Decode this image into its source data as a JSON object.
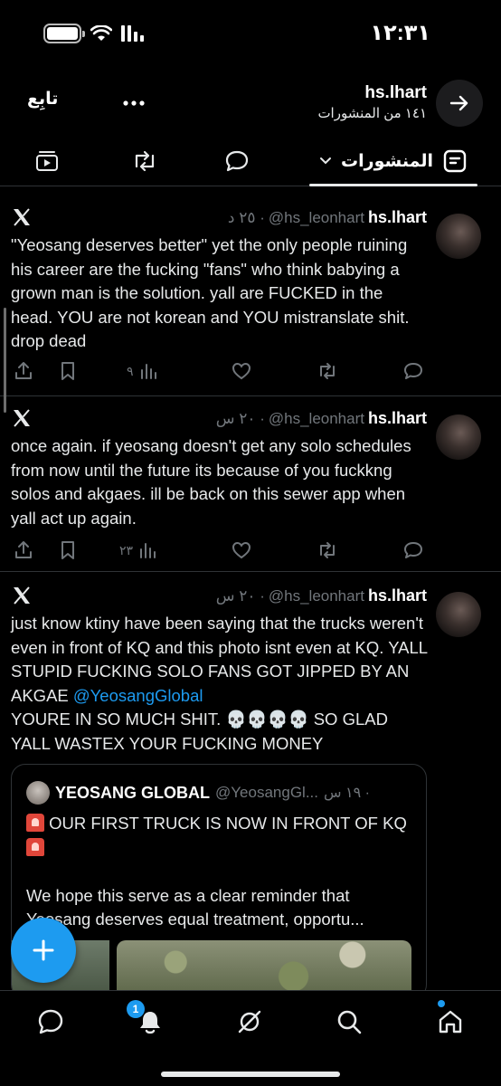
{
  "status_bar": {
    "time": "١٢:٣١"
  },
  "header": {
    "name": "hs.lhart",
    "post_count_label": "١٤١ من المنشورات",
    "follow_label": "تابِع"
  },
  "tabs": {
    "posts_label": "المنشورات"
  },
  "posts": [
    {
      "name": "hs.lhart",
      "handle": "@hs_leonhart",
      "time": "· ٢٥ د",
      "text": "\"Yeosang deserves better\" yet the only people ruining his career are the fucking \"fans\" who think babying a grown man is the solution. yall are FUCKED in the head. YOU are not korean and YOU mistranslate shit. drop dead",
      "views": "٩"
    },
    {
      "name": "hs.lhart",
      "handle": "@hs_leonhart",
      "time": "· ٢٠ س",
      "text": "once again. if yeosang doesn't get any solo schedules from now until the future its because of you fuckkng solos and akgaes. ill be back on this sewer app when yall act up again.",
      "views": "٢٣"
    },
    {
      "name": "hs.lhart",
      "handle": "@hs_leonhart",
      "time": "· ٢٠ س",
      "text_before": "just know ktiny have been saying that the trucks weren't even in front of KQ and this photo isnt even at KQ. YALL STUPID FUCKING SOLO FANS GOT JIPPED BY AN AKGAE ",
      "mention": "@YeosangGlobal",
      "text_after": "\nYOURE IN SO MUCH SHIT. 💀💀💀💀 SO GLAD YALL WASTEX YOUR FUCKING MONEY",
      "quote": {
        "name": "YEOSANG GLOBAL",
        "handle": "@YeosangGl...",
        "time": "· ١٩ س",
        "line1": " OUR FIRST TRUCK IS NOW IN FRONT OF KQ ",
        "line2": "We hope this serve as a clear reminder that Yeosang deserves equal treatment, opportu..."
      }
    }
  ],
  "bottom_nav": {
    "notification_count": "1"
  },
  "colors": {
    "accent": "#1d9bf0",
    "muted": "#71767b",
    "border": "#2f3336"
  },
  "icons": [
    "arrow-right-icon",
    "more-icon",
    "posts-tab-icon",
    "chevron-down-icon",
    "reply-icon",
    "repost-icon",
    "media-icon",
    "x-logo-icon",
    "share-icon",
    "bookmark-icon",
    "views-icon",
    "like-icon",
    "plus-icon",
    "messages-icon",
    "bell-icon",
    "grok-icon",
    "search-icon",
    "home-icon"
  ]
}
